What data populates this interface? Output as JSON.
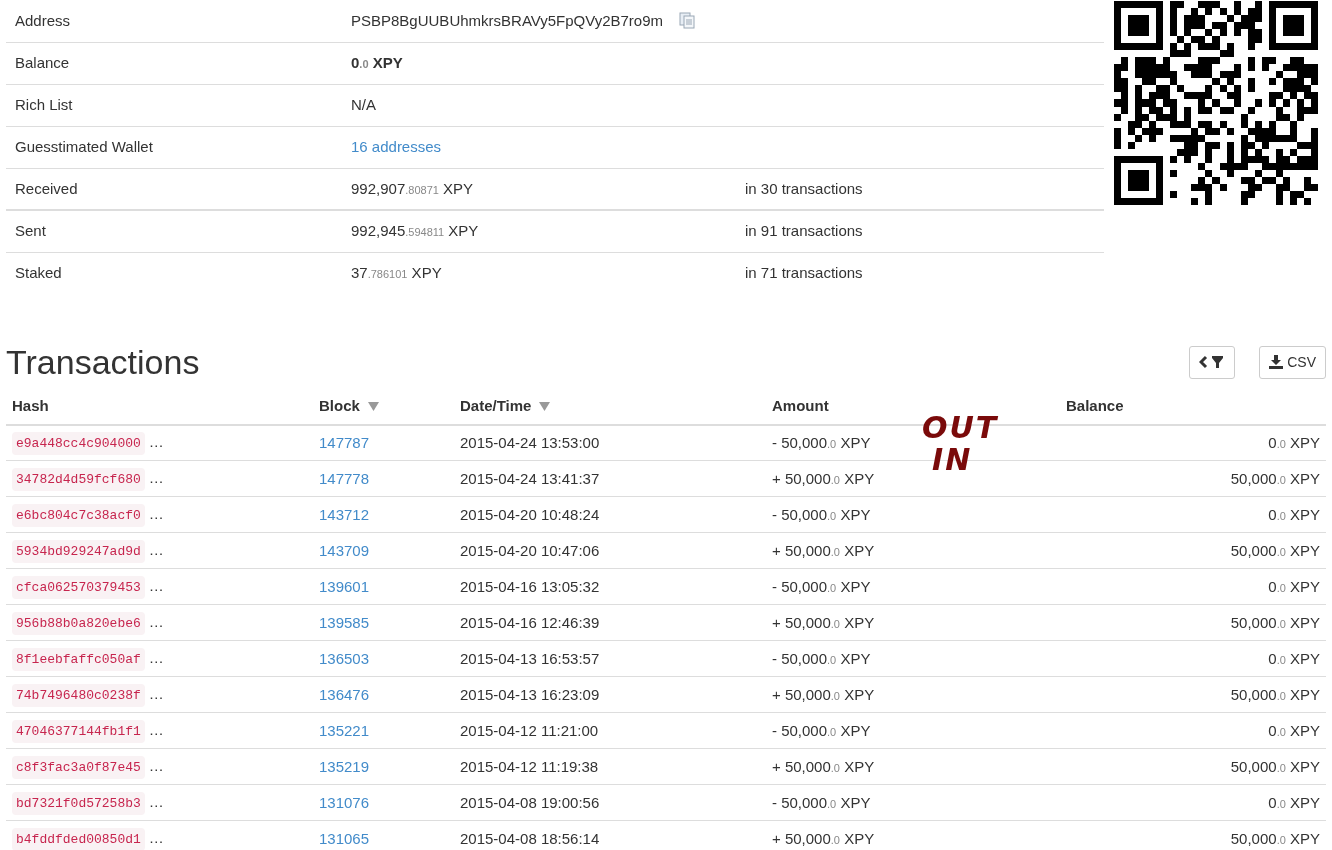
{
  "summary": [
    {
      "kind": "address",
      "label": "Address",
      "value": "PSBP8BgUUBUhmkrsBRAVy5FpQVy2B7ro9m"
    },
    {
      "kind": "amount_bold",
      "label": "Balance",
      "whole": "0",
      "fraction": ".0",
      "unit": "XPY"
    },
    {
      "kind": "text",
      "label": "Rich List",
      "value": "N/A"
    },
    {
      "kind": "link",
      "label": "Guesstimated Wallet",
      "value": "16 addresses"
    },
    {
      "kind": "amount",
      "label": "Received",
      "whole": "992,907",
      "fraction": ".80871",
      "unit": "XPY",
      "note": "in 30 transactions"
    },
    {
      "kind": "amount",
      "label": "Sent",
      "whole": "992,945",
      "fraction": ".594811",
      "unit": "XPY",
      "note": "in 91 transactions"
    },
    {
      "kind": "amount",
      "label": "Staked",
      "whole": "37",
      "fraction": ".786101",
      "unit": "XPY",
      "note": "in 71 transactions"
    }
  ],
  "transactions": {
    "title": "Transactions",
    "csv_button": "CSV",
    "columns": [
      {
        "label": "Hash",
        "sortable": false
      },
      {
        "label": "Block",
        "sortable": true
      },
      {
        "label": "Date/Time",
        "sortable": true
      },
      {
        "label": "Amount",
        "sortable": false
      },
      {
        "label": "Balance",
        "sortable": false
      }
    ],
    "rows": [
      {
        "hash": "e9a448cc4c904000",
        "more": "…",
        "block": "147787",
        "datetime": "2015-04-24 13:53:00",
        "amount": {
          "whole": "- 50,000",
          "fraction": ".0",
          "unit": "XPY"
        },
        "balance": {
          "whole": "0",
          "fraction": ".0",
          "unit": "XPY"
        }
      },
      {
        "hash": "34782d4d59fcf680",
        "more": "…",
        "block": "147778",
        "datetime": "2015-04-24 13:41:37",
        "amount": {
          "whole": "+ 50,000",
          "fraction": ".0",
          "unit": "XPY"
        },
        "balance": {
          "whole": "50,000",
          "fraction": ".0",
          "unit": "XPY"
        }
      },
      {
        "hash": "e6bc804c7c38acf0",
        "more": "…",
        "block": "143712",
        "datetime": "2015-04-20 10:48:24",
        "amount": {
          "whole": "- 50,000",
          "fraction": ".0",
          "unit": "XPY"
        },
        "balance": {
          "whole": "0",
          "fraction": ".0",
          "unit": "XPY"
        }
      },
      {
        "hash": "5934bd929247ad9d",
        "more": "…",
        "block": "143709",
        "datetime": "2015-04-20 10:47:06",
        "amount": {
          "whole": "+ 50,000",
          "fraction": ".0",
          "unit": "XPY"
        },
        "balance": {
          "whole": "50,000",
          "fraction": ".0",
          "unit": "XPY"
        }
      },
      {
        "hash": "cfca062570379453",
        "more": "…",
        "block": "139601",
        "datetime": "2015-04-16 13:05:32",
        "amount": {
          "whole": "- 50,000",
          "fraction": ".0",
          "unit": "XPY"
        },
        "balance": {
          "whole": "0",
          "fraction": ".0",
          "unit": "XPY"
        }
      },
      {
        "hash": "956b88b0a820ebe6",
        "more": "…",
        "block": "139585",
        "datetime": "2015-04-16 12:46:39",
        "amount": {
          "whole": "+ 50,000",
          "fraction": ".0",
          "unit": "XPY"
        },
        "balance": {
          "whole": "50,000",
          "fraction": ".0",
          "unit": "XPY"
        }
      },
      {
        "hash": "8f1eebfaffc050af",
        "more": "…",
        "block": "136503",
        "datetime": "2015-04-13 16:53:57",
        "amount": {
          "whole": "- 50,000",
          "fraction": ".0",
          "unit": "XPY"
        },
        "balance": {
          "whole": "0",
          "fraction": ".0",
          "unit": "XPY"
        }
      },
      {
        "hash": "74b7496480c0238f",
        "more": "…",
        "block": "136476",
        "datetime": "2015-04-13 16:23:09",
        "amount": {
          "whole": "+ 50,000",
          "fraction": ".0",
          "unit": "XPY"
        },
        "balance": {
          "whole": "50,000",
          "fraction": ".0",
          "unit": "XPY"
        }
      },
      {
        "hash": "47046377144fb1f1",
        "more": "…",
        "block": "135221",
        "datetime": "2015-04-12 11:21:00",
        "amount": {
          "whole": "- 50,000",
          "fraction": ".0",
          "unit": "XPY"
        },
        "balance": {
          "whole": "0",
          "fraction": ".0",
          "unit": "XPY"
        }
      },
      {
        "hash": "c8f3fac3a0f87e45",
        "more": "…",
        "block": "135219",
        "datetime": "2015-04-12 11:19:38",
        "amount": {
          "whole": "+ 50,000",
          "fraction": ".0",
          "unit": "XPY"
        },
        "balance": {
          "whole": "50,000",
          "fraction": ".0",
          "unit": "XPY"
        }
      },
      {
        "hash": "bd7321f0d57258b3",
        "more": "…",
        "block": "131076",
        "datetime": "2015-04-08 19:00:56",
        "amount": {
          "whole": "- 50,000",
          "fraction": ".0",
          "unit": "XPY"
        },
        "balance": {
          "whole": "0",
          "fraction": ".0",
          "unit": "XPY"
        }
      },
      {
        "hash": "b4fddfded00850d1",
        "more": "…",
        "block": "131065",
        "datetime": "2015-04-08 18:56:14",
        "amount": {
          "whole": "+ 50,000",
          "fraction": ".0",
          "unit": "XPY"
        },
        "balance": {
          "whole": "50,000",
          "fraction": ".0",
          "unit": "XPY"
        }
      }
    ]
  },
  "annotations": [
    "OUT",
    "IN"
  ]
}
